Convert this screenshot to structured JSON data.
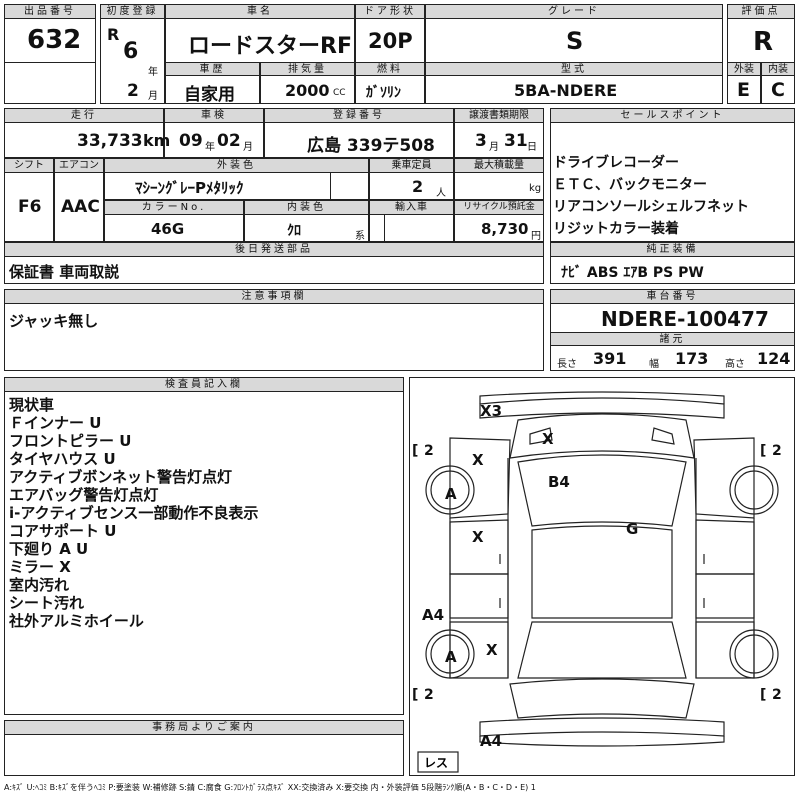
{
  "headers": {
    "lot_no": "出品番号",
    "first_reg": "初度登録",
    "car_name": "車名",
    "door": "ドア形状",
    "grade": "グレード",
    "score": "評価点",
    "ext": "外装",
    "int": "内装",
    "history": "車歴",
    "displacement": "排気量",
    "fuel": "燃料",
    "model": "型式",
    "mileage": "走行",
    "inspection": "車検",
    "reg_no": "登録番号",
    "transfer": "譲渡書類期限",
    "sales_point": "セールスポイント",
    "shift": "シフト",
    "ac": "エアコン",
    "ext_color": "外装色",
    "capacity": "乗車定員",
    "max_load": "最大積載量",
    "color_no": "カラーNo.",
    "int_color": "内装色",
    "import": "輸入車",
    "recycle": "リサイクル預託金",
    "later_parts": "後日発送部品",
    "std_equip": "純正装備",
    "notes": "注意事項欄",
    "chassis": "車台番号",
    "dims": "諸元",
    "inspector": "検査員記入欄",
    "office": "事務局よりご案内"
  },
  "lot_no": "632",
  "era_mark": "R",
  "reg_year": "6",
  "year_unit": "年",
  "reg_month": "2",
  "month_unit": "月",
  "car_name": "ロードスターRF",
  "door": "20P",
  "grade": "S",
  "score": "R",
  "ext_grade": "E",
  "int_grade": "C",
  "history": "自家用",
  "displacement": "2000",
  "cc_unit": "CC",
  "fuel": "ｶﾞｿﾘﾝ",
  "model": "5BA-NDERE",
  "mileage": "33,733",
  "km_unit": "km",
  "insp_year": "09",
  "insp_month": "02",
  "reg_no": "広島 339テ508",
  "transfer_month": "3",
  "transfer_day": "31",
  "day_unit": "日",
  "sales_points": [
    "ドライブレコーダー",
    "ＥＴＣ、バックモニター",
    "リアコンソールシェルフネット",
    "リジットカラー装着"
  ],
  "shift": "F6",
  "ac": "AAC",
  "ext_color": "ﾏｼｰﾝｸﾞﾚｰPﾒﾀﾘｯｸ",
  "capacity": "2",
  "person_unit": "人",
  "kg_unit": "kg",
  "color_no": "46G",
  "int_color": "ｸﾛ",
  "kei_unit": "系",
  "recycle": "8,730",
  "yen_unit": "円",
  "later_parts": "保証書 車両取説",
  "std_equip": "ﾅﾋﾞ ABS ｴｱB PS PW",
  "notes": "ジャッキ無し",
  "chassis": "NDERE-100477",
  "len_label": "長さ",
  "length": "391",
  "wid_label": "幅",
  "width": "173",
  "hei_label": "高さ",
  "height": "124",
  "inspector_notes": [
    "現状車",
    "Ｆインナー U",
    "フロントピラー U",
    "タイヤハウス U",
    "アクティブボンネット警告灯点灯",
    "エアバッグ警告灯点灯",
    "i-アクティブセンス一部動作不良表示",
    "コアサポート U",
    "下廻り A U",
    "ミラー X",
    "室内汚れ",
    "シート汚れ",
    "社外アルミホイール"
  ],
  "diagram_marks": {
    "front": "X3",
    "hood": "X",
    "lf": "X",
    "windshield": "B4",
    "roof": "G",
    "lfd": "X",
    "lrq": "A4",
    "lr": "X",
    "rear": "A4",
    "lf_tire": "A",
    "lr_tire": "A",
    "tread": "2",
    "spare": "レス"
  },
  "legend": "A:ｷｽﾞ U:ﾍｺﾐ B:ｷｽﾞを伴うﾍｺﾐ P:要塗装 W:補修跡 S:錆 C:腐食 G:ﾌﾛﾝﾄｶﾞﾗｽ点ｷｽﾞ XX:交換済み X:要交換 内・外装評価 5段階ﾗﾝｸ順(A・B・C・D・E) 1"
}
